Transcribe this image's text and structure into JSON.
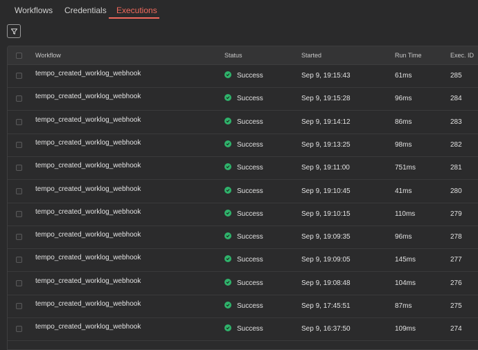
{
  "tabs": [
    {
      "label": "Workflows"
    },
    {
      "label": "Credentials"
    },
    {
      "label": "Executions",
      "active": true
    }
  ],
  "filter": {
    "icon": "filter-icon"
  },
  "table": {
    "headers": {
      "workflow": "Workflow",
      "status": "Status",
      "started": "Started",
      "run_time": "Run Time",
      "exec_id": "Exec. ID"
    },
    "rows": [
      {
        "workflow": "tempo_created_worklog_webhook",
        "status": "Success",
        "started": "Sep 9, 19:15:43",
        "run_time": "61ms",
        "exec_id": "285"
      },
      {
        "workflow": "tempo_created_worklog_webhook",
        "status": "Success",
        "started": "Sep 9, 19:15:28",
        "run_time": "96ms",
        "exec_id": "284"
      },
      {
        "workflow": "tempo_created_worklog_webhook",
        "status": "Success",
        "started": "Sep 9, 19:14:12",
        "run_time": "86ms",
        "exec_id": "283"
      },
      {
        "workflow": "tempo_created_worklog_webhook",
        "status": "Success",
        "started": "Sep 9, 19:13:25",
        "run_time": "98ms",
        "exec_id": "282"
      },
      {
        "workflow": "tempo_created_worklog_webhook",
        "status": "Success",
        "started": "Sep 9, 19:11:00",
        "run_time": "751ms",
        "exec_id": "281"
      },
      {
        "workflow": "tempo_created_worklog_webhook",
        "status": "Success",
        "started": "Sep 9, 19:10:45",
        "run_time": "41ms",
        "exec_id": "280"
      },
      {
        "workflow": "tempo_created_worklog_webhook",
        "status": "Success",
        "started": "Sep 9, 19:10:15",
        "run_time": "110ms",
        "exec_id": "279"
      },
      {
        "workflow": "tempo_created_worklog_webhook",
        "status": "Success",
        "started": "Sep 9, 19:09:35",
        "run_time": "96ms",
        "exec_id": "278"
      },
      {
        "workflow": "tempo_created_worklog_webhook",
        "status": "Success",
        "started": "Sep 9, 19:09:05",
        "run_time": "145ms",
        "exec_id": "277"
      },
      {
        "workflow": "tempo_created_worklog_webhook",
        "status": "Success",
        "started": "Sep 9, 19:08:48",
        "run_time": "104ms",
        "exec_id": "276"
      },
      {
        "workflow": "tempo_created_worklog_webhook",
        "status": "Success",
        "started": "Sep 9, 17:45:51",
        "run_time": "87ms",
        "exec_id": "275"
      },
      {
        "workflow": "tempo_created_worklog_webhook",
        "status": "Success",
        "started": "Sep 9, 16:37:50",
        "run_time": "109ms",
        "exec_id": "274"
      }
    ]
  },
  "colors": {
    "accent": "#f36a5d",
    "success": "#2fb36b",
    "background": "#2a2a2b"
  }
}
